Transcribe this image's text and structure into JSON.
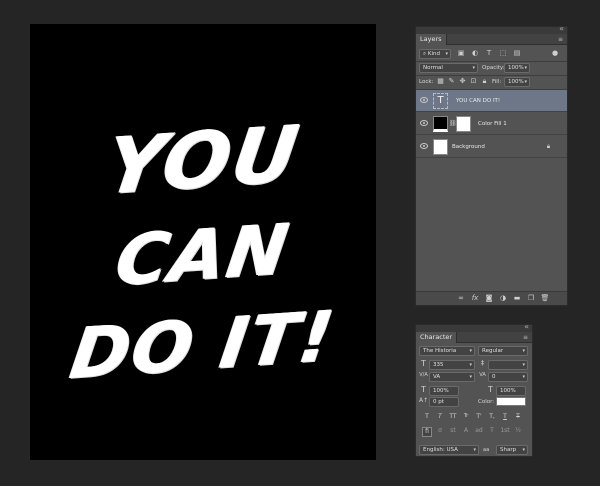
{
  "canvas": {
    "line1": "YOU",
    "line2": "CAN",
    "line3": "DO IT!",
    "background_color": "#000000",
    "text_color": "#ffffff"
  },
  "layers_panel": {
    "tab_label": "Layers",
    "filter_kind": "Kind",
    "blend_mode": "Normal",
    "opacity_label": "Opacity:",
    "opacity_value": "100%",
    "lock_label": "Lock:",
    "fill_label": "Fill:",
    "fill_value": "100%",
    "layers": [
      {
        "name": "YOU CAN  DO IT!",
        "type": "text",
        "thumb_glyph": "T",
        "selected": true
      },
      {
        "name": "Color Fill 1",
        "type": "fill",
        "selected": false
      },
      {
        "name": "Background",
        "type": "background",
        "selected": false
      }
    ],
    "selection_color": "#6e7787"
  },
  "character_panel": {
    "tab_label": "Character",
    "font_family": "The Historia",
    "font_style": "Regular",
    "font_size": "335",
    "kerning": "VA",
    "tracking": "0",
    "vertical_scale": "100%",
    "horizontal_scale": "100%",
    "baseline_shift": "0 pt",
    "color_label": "Color:",
    "color_value": "#ffffff",
    "language": "English: USA",
    "antialias_label": "aa",
    "antialias": "Sharp",
    "type_style_buttons": [
      "T",
      "T",
      "TT",
      "Tr",
      "T'",
      "T,",
      "T",
      "T"
    ],
    "opentype_buttons": [
      "fi",
      "ơ",
      "st",
      "A",
      "ad",
      "T",
      "1st",
      "½"
    ]
  }
}
